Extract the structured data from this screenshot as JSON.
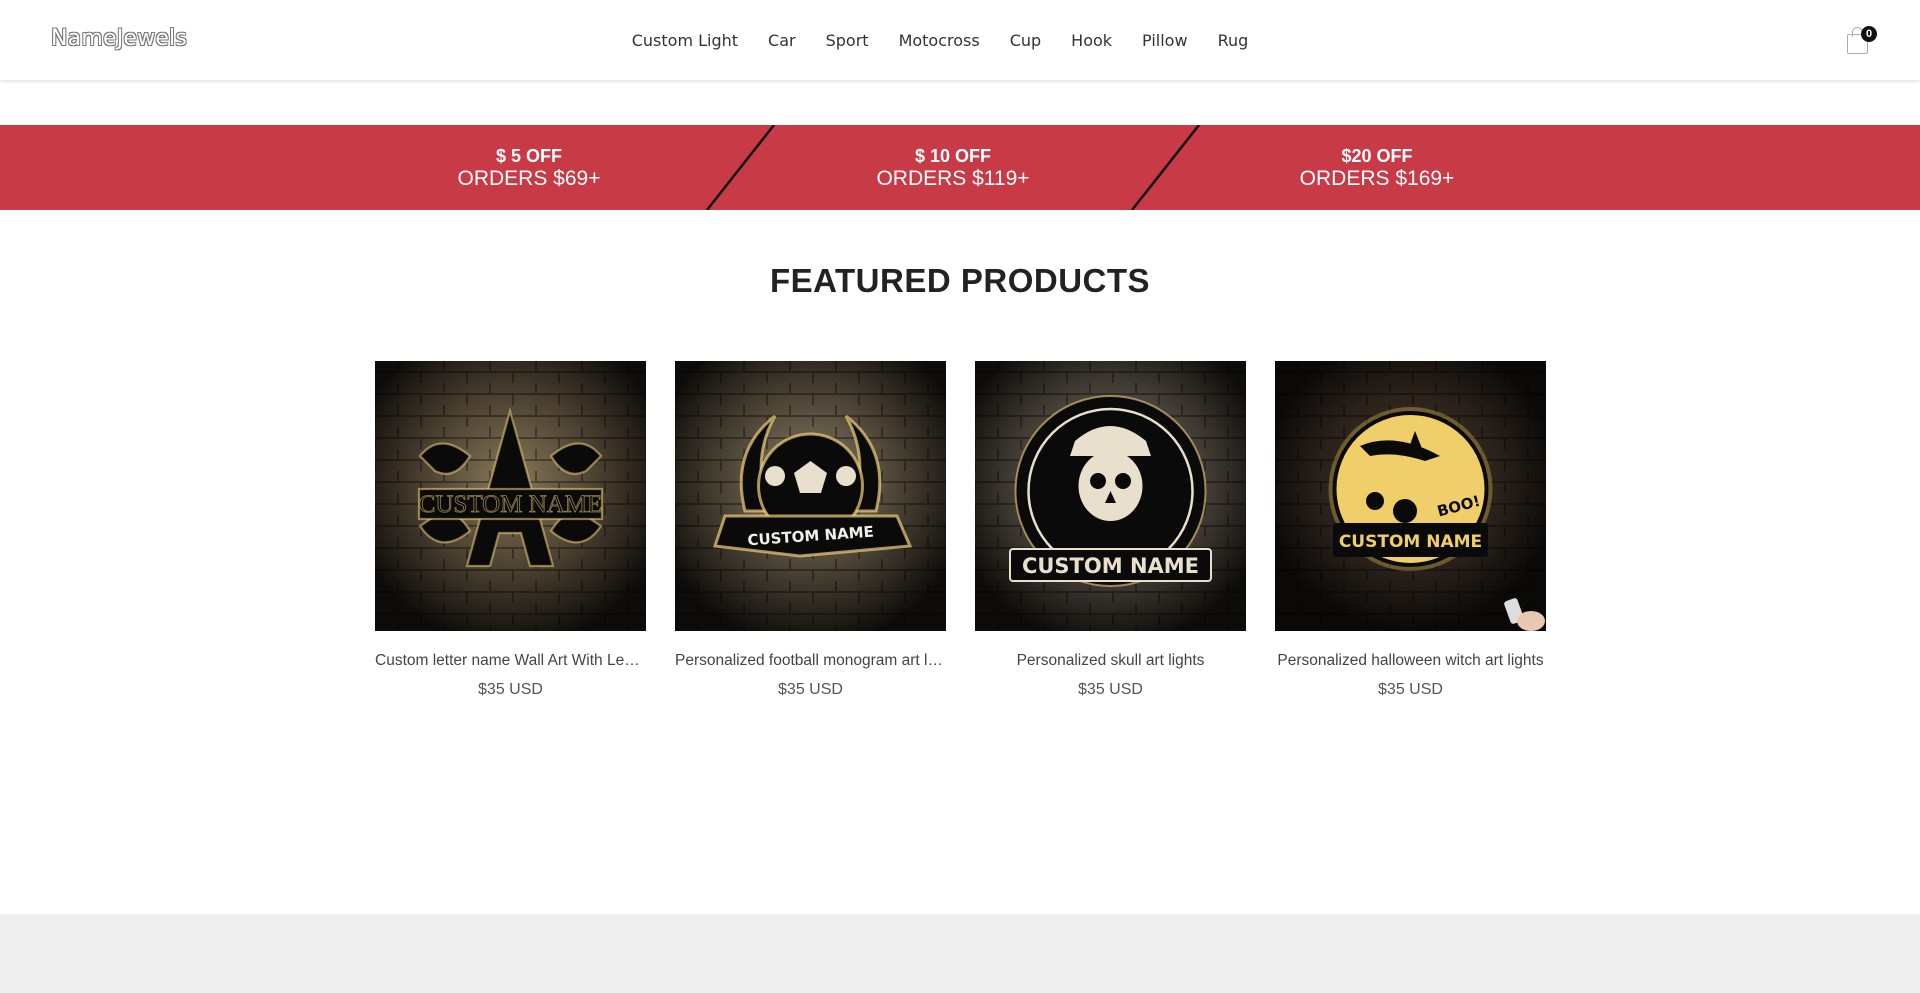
{
  "header": {
    "logo": "NameJewels",
    "nav": [
      "Custom Light",
      "Car",
      "Sport",
      "Motocross",
      "Cup",
      "Hook",
      "Pillow",
      "Rug"
    ],
    "cart_count": "0",
    "cart_icon": "shopping-bag-icon"
  },
  "promo": [
    {
      "top": "$ 5 OFF",
      "bottom": "ORDERS $69+"
    },
    {
      "top": "$ 10 OFF",
      "bottom": "ORDERS $119+"
    },
    {
      "top": "$20 OFF",
      "bottom": "ORDERS $169+"
    }
  ],
  "featured": {
    "title": "FEATURED PRODUCTS",
    "products": [
      {
        "title": "Custom letter name Wall Art With Led Lights",
        "price": "$35 USD",
        "image_text": "CUSTOM NAME"
      },
      {
        "title": "Personalized football monogram art lights",
        "price": "$35 USD",
        "image_text": "CUSTOM NAME"
      },
      {
        "title": "Personalized skull art lights",
        "price": "$35 USD",
        "image_text": "CUSTOM NAME"
      },
      {
        "title": "Personalized halloween witch art lights",
        "price": "$35 USD",
        "image_text": "CUSTOM NAME",
        "image_text_2": "BOO!"
      }
    ]
  },
  "colors": {
    "promo_bg": "#c93a47",
    "footer_bg": "#efefef",
    "glow": "#f2d27a"
  }
}
